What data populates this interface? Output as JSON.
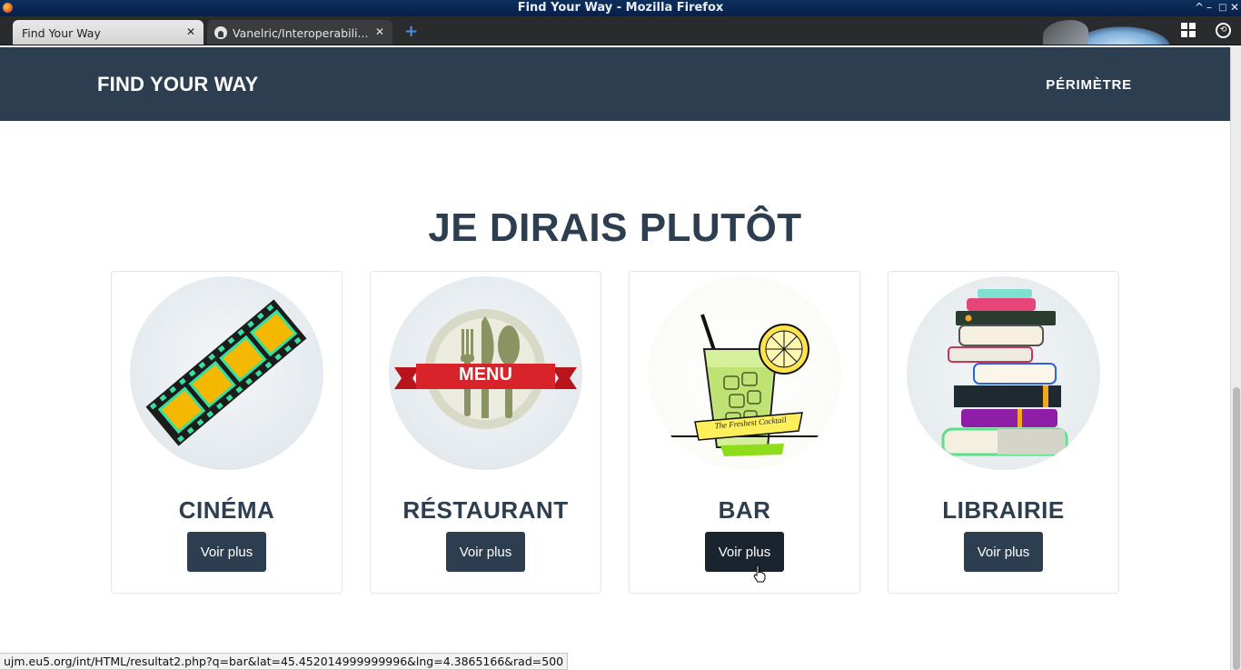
{
  "window": {
    "title": "Find Your Way - Mozilla Firefox",
    "controls": [
      "^",
      "–",
      "□",
      "✕"
    ]
  },
  "tabs": [
    {
      "label": "Find Your Way",
      "active": true
    },
    {
      "label": "Vanelric/Interoperabili...",
      "active": false
    }
  ],
  "newtab_symbol": "+",
  "site": {
    "brand": "FIND YOUR WAY",
    "nav_link": "PÉRIMÈTRE",
    "heading": "JE DIRAIS PLUTÔT",
    "colors": {
      "navbar": "#2c3e50",
      "button": "#2c3e50",
      "button_hover": "#1a242f",
      "text": "#2c3e50"
    },
    "categories": [
      {
        "title": "CINÉMA",
        "button": "Voir plus",
        "icon": "film-strip-icon"
      },
      {
        "title": "RÉSTAURANT",
        "button": "Voir plus",
        "icon": "restaurant-menu-icon",
        "banner": "MENU"
      },
      {
        "title": "BAR",
        "button": "Voir plus",
        "icon": "cocktail-icon",
        "ribbon": "The Freshest Cocktail",
        "hovered": true
      },
      {
        "title": "LIBRAIRIE",
        "button": "Voir plus",
        "icon": "book-stack-icon"
      }
    ]
  },
  "status_url": "ujm.eu5.org/int/HTML/resultat2.php?q=bar&lat=45.452014999999996&lng=4.3865166&rad=500"
}
